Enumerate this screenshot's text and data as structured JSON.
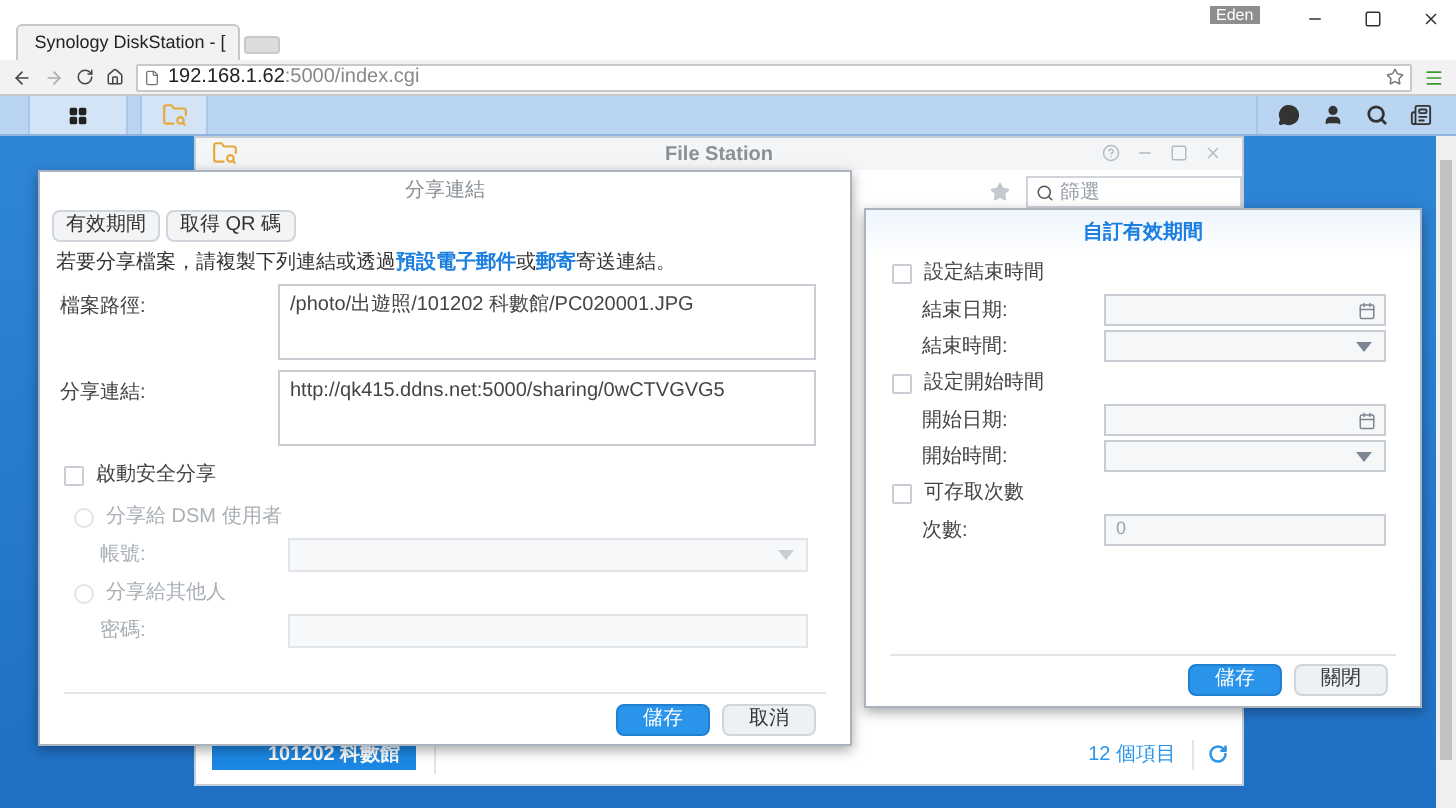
{
  "browser": {
    "tab": {
      "title": "Synology DiskStation - ["
    },
    "user": "Eden",
    "url": {
      "host": "192.168.1.62",
      "rest": ":5000/index.cgi"
    }
  },
  "file_station": {
    "title": "File Station",
    "filter": {
      "placeholder": "篩選"
    },
    "sidebar_item": {
      "label": "101202 科數館",
      "selected": true
    },
    "item_count": "12 個項目"
  },
  "share_dialog": {
    "title": "分享連結",
    "tabs": [
      {
        "label": "有效期間"
      },
      {
        "label": "取得 QR 碼"
      }
    ],
    "description": [
      {
        "kind": "text",
        "text": "若要分享檔案，請複製下列連結或透過"
      },
      {
        "kind": "link",
        "text": "預設電子郵件"
      },
      {
        "kind": "text",
        "text": "或"
      },
      {
        "kind": "link",
        "text": "郵寄"
      },
      {
        "kind": "text",
        "text": "寄送連結。"
      }
    ],
    "fields": [
      {
        "label": "檔案路徑:",
        "value": "/photo/出遊照/101202 科數館/PC020001.JPG"
      },
      {
        "label": "分享連結:",
        "value": "http://qk415.ddns.net:5000/sharing/0wCTVGVG5"
      }
    ],
    "secure_share": {
      "label": "啟動安全分享",
      "checked": false
    },
    "options": [
      {
        "label": "分享給 DSM 使用者",
        "selected": false,
        "disabled": true,
        "field": {
          "label": "帳號:",
          "kind": "select"
        }
      },
      {
        "label": "分享給其他人",
        "selected": false,
        "disabled": true,
        "field": {
          "label": "密碼:",
          "kind": "text"
        }
      }
    ],
    "buttons": [
      {
        "label": "儲存",
        "primary": true
      },
      {
        "label": "取消",
        "primary": false
      }
    ]
  },
  "validity_dialog": {
    "title": "自訂有效期間",
    "sections": [
      {
        "label": "設定結束時間",
        "checked": false,
        "fields": [
          {
            "label": "結束日期:",
            "kind": "date"
          },
          {
            "label": "結束時間:",
            "kind": "select"
          }
        ]
      },
      {
        "label": "設定開始時間",
        "checked": false,
        "fields": [
          {
            "label": "開始日期:",
            "kind": "date"
          },
          {
            "label": "開始時間:",
            "kind": "select"
          }
        ]
      },
      {
        "label": "可存取次數",
        "checked": false,
        "fields": [
          {
            "label": "次數:",
            "kind": "number",
            "placeholder": "0"
          }
        ]
      }
    ],
    "buttons": [
      {
        "label": "儲存",
        "primary": true
      },
      {
        "label": "關閉",
        "primary": false
      }
    ]
  }
}
